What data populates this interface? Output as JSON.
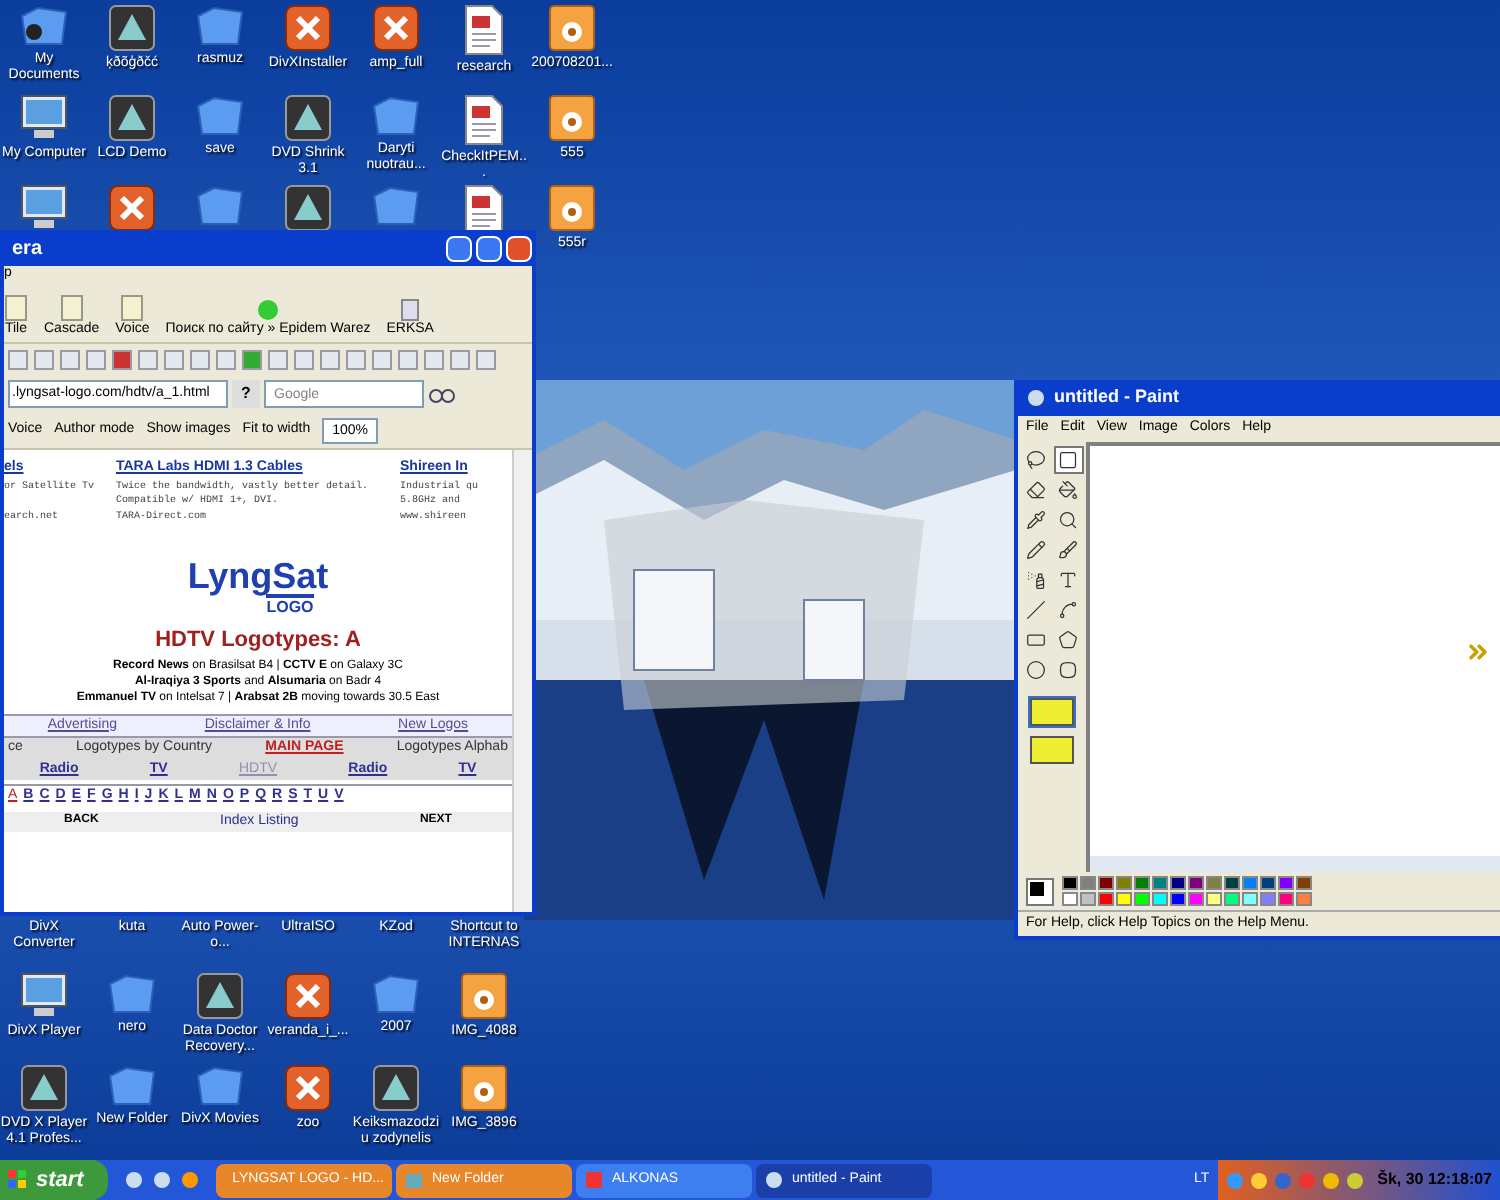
{
  "desktop": {
    "top_rows": [
      [
        {
          "kind": "user-docs",
          "label": "My Documents"
        },
        {
          "kind": "app",
          "label": "ķðõģðčć"
        },
        {
          "kind": "folder",
          "label": "rasmuz"
        },
        {
          "kind": "app-red",
          "label": "DivXInstaller"
        },
        {
          "kind": "app-red",
          "label": "amp_full"
        },
        {
          "kind": "doc",
          "label": "research"
        },
        {
          "kind": "image",
          "label": "200708201..."
        }
      ],
      [
        {
          "kind": "computer",
          "label": "My Computer"
        },
        {
          "kind": "app",
          "label": "LCD Demo"
        },
        {
          "kind": "folder",
          "label": "save"
        },
        {
          "kind": "app",
          "label": "DVD Shrink 3.1"
        },
        {
          "kind": "folder",
          "label": "Daryti nuotrau..."
        },
        {
          "kind": "doc",
          "label": "CheckItPEM..."
        },
        {
          "kind": "image",
          "label": "555"
        }
      ],
      [
        {
          "kind": "computer"
        },
        {
          "kind": "app-red"
        },
        {
          "kind": "folder"
        },
        {
          "kind": "app"
        },
        {
          "kind": "folder"
        },
        {
          "kind": "doc"
        },
        {
          "kind": "image",
          "label": "555r"
        }
      ]
    ],
    "bottom_rows": [
      [
        {
          "kind": "none",
          "label": "DivX Converter"
        },
        {
          "kind": "none",
          "label": "kuta"
        },
        {
          "kind": "none",
          "label": "Auto Power-o..."
        },
        {
          "kind": "none",
          "label": "UltraISO"
        },
        {
          "kind": "none",
          "label": "KZod"
        },
        {
          "kind": "none",
          "label": "Shortcut to INTERNAS"
        }
      ],
      [
        {
          "kind": "computer",
          "label": "DivX Player"
        },
        {
          "kind": "folder",
          "label": "nero"
        },
        {
          "kind": "app",
          "label": "Data Doctor Recovery..."
        },
        {
          "kind": "app-red",
          "label": "veranda_i_..."
        },
        {
          "kind": "folder",
          "label": "2007"
        },
        {
          "kind": "image",
          "label": "IMG_4088"
        }
      ],
      [
        {
          "kind": "app",
          "label": "DVD X Player 4.1 Profes..."
        },
        {
          "kind": "folder",
          "label": "New Folder"
        },
        {
          "kind": "folder",
          "label": "DivX Movies"
        },
        {
          "kind": "app-red",
          "label": "zoo"
        },
        {
          "kind": "app",
          "label": "Keiksmazodziu zodynelis"
        },
        {
          "kind": "image",
          "label": "IMG_3896"
        }
      ]
    ]
  },
  "browser": {
    "title": "era",
    "menu": "p",
    "toolbar": [
      "Tile",
      "Cascade",
      "Voice",
      "Поиск по сайту » Epidem Warez",
      "ERKSA"
    ],
    "address": ".lyngsat-logo.com/hdtv/a_1.html",
    "help": "?",
    "search_placeholder": "Google",
    "toolbar2": [
      "Voice",
      "Author mode",
      "Show images",
      "Fit to width",
      "100%"
    ],
    "ads": [
      {
        "title": "els",
        "lines": [
          "or Satellite Tv",
          "earch.net"
        ]
      },
      {
        "title": "TARA Labs HDMI 1.3 Cables",
        "lines": [
          "Twice the bandwidth, vastly better detail.",
          "Compatible w/ HDMI 1+, DVI.",
          "TARA-Direct.com"
        ]
      },
      {
        "title": "Shireen In",
        "lines": [
          "Industrial qu",
          "5.8GHz and",
          "www.shireen"
        ]
      }
    ],
    "logo": {
      "name": "LyngSat",
      "sub": "LOGO"
    },
    "heading": "HDTV Logotypes: A",
    "news": [
      "**Record News** on Brasilsat B4 | **CCTV E** on Galaxy 3C",
      "**Al-Iraqiya 3 Sports** and **Alsumaria** on Badr 4",
      "**Emmanuel TV** on Intelsat 7 | **Arabsat 2B** moving towards 30.5 East"
    ],
    "nav": [
      "Advertising",
      "Disclaimer & Info",
      "New Logos"
    ],
    "sections": [
      "ce",
      "Logotypes by Country",
      "MAIN PAGE",
      "Logotypes Alphab"
    ],
    "sublinks": [
      "Radio",
      "TV",
      "HDTV",
      "Radio",
      "TV"
    ],
    "letters": [
      "A",
      "B",
      "C",
      "D",
      "E",
      "F",
      "G",
      "H",
      "I",
      "J",
      "K",
      "L",
      "M",
      "N",
      "O",
      "P",
      "Q",
      "R",
      "S",
      "T",
      "U",
      "V"
    ],
    "back": "BACK",
    "index": "Index Listing",
    "next": "NEXT"
  },
  "paint": {
    "title": "untitled - Paint",
    "menu": [
      "File",
      "Edit",
      "View",
      "Image",
      "Colors",
      "Help"
    ],
    "tools": [
      {
        "kind": "lasso",
        "selected": false
      },
      {
        "kind": "select",
        "selected": true
      },
      {
        "kind": "eraser",
        "selected": false
      },
      {
        "kind": "fill",
        "selected": false
      },
      {
        "kind": "picker",
        "selected": false
      },
      {
        "kind": "zoom",
        "selected": false
      },
      {
        "kind": "pencil",
        "selected": false
      },
      {
        "kind": "brush",
        "selected": false
      },
      {
        "kind": "spray",
        "selected": false
      },
      {
        "kind": "text",
        "selected": false
      },
      {
        "kind": "line",
        "selected": false
      },
      {
        "kind": "curve",
        "selected": false
      },
      {
        "kind": "rect",
        "selected": false
      },
      {
        "kind": "polygon",
        "selected": false
      },
      {
        "kind": "ellipse",
        "selected": false
      },
      {
        "kind": "rounded",
        "selected": false
      }
    ],
    "options": [
      {
        "selected": true
      },
      {
        "selected": false
      }
    ],
    "palette": [
      {
        "color": "#000000"
      },
      {
        "color": "#808080"
      },
      {
        "color": "#800000"
      },
      {
        "color": "#808000"
      },
      {
        "color": "#008000"
      },
      {
        "color": "#008080"
      },
      {
        "color": "#000080"
      },
      {
        "color": "#800080"
      },
      {
        "color": "#808040"
      },
      {
        "color": "#004040"
      },
      {
        "color": "#0080ff"
      },
      {
        "color": "#004080"
      },
      {
        "color": "#8000ff"
      },
      {
        "color": "#804000"
      },
      {
        "color": "#ffffff"
      },
      {
        "color": "#c0c0c0"
      },
      {
        "color": "#ff0000"
      },
      {
        "color": "#ffff00"
      },
      {
        "color": "#00ff00"
      },
      {
        "color": "#00ffff"
      },
      {
        "color": "#0000ff"
      },
      {
        "color": "#ff00ff"
      },
      {
        "color": "#ffff80"
      },
      {
        "color": "#00ff80"
      },
      {
        "color": "#80ffff"
      },
      {
        "color": "#8080ff"
      },
      {
        "color": "#ff0080"
      },
      {
        "color": "#ff8040"
      }
    ],
    "status": "For Help, click Help Topics on the Help Menu."
  },
  "taskbar": {
    "start": "start",
    "tasks": [
      {
        "label": "LYNGSAT LOGO - HD...",
        "kind": "browser",
        "selected": false
      },
      {
        "label": "New Folder",
        "kind": "folder",
        "selected": false
      },
      {
        "label": "ALKONAS",
        "kind": "app",
        "selected": false
      },
      {
        "label": "untitled - Paint",
        "kind": "paint",
        "selected": true
      }
    ],
    "language": "LT",
    "clock": "Šk, 30 12:18:07"
  }
}
